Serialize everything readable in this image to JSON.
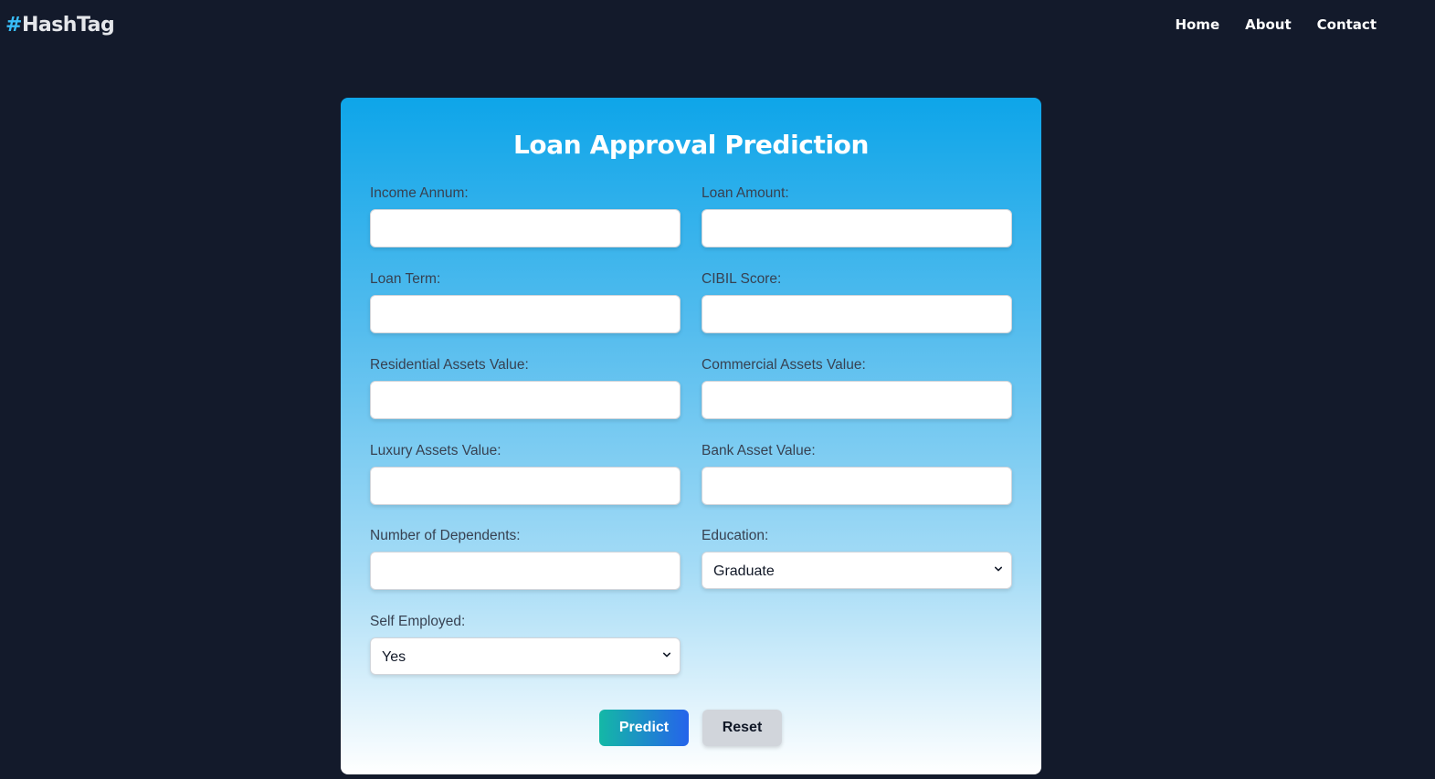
{
  "brand": {
    "hash": "#",
    "name": "HashTag"
  },
  "nav": {
    "links": [
      "Home",
      "About",
      "Contact"
    ]
  },
  "form": {
    "title": "Loan Approval Prediction",
    "fields": {
      "income_annum": {
        "label": "Income Annum:",
        "value": ""
      },
      "loan_amount": {
        "label": "Loan Amount:",
        "value": ""
      },
      "loan_term": {
        "label": "Loan Term:",
        "value": ""
      },
      "cibil_score": {
        "label": "CIBIL Score:",
        "value": ""
      },
      "residential_assets": {
        "label": "Residential Assets Value:",
        "value": ""
      },
      "commercial_assets": {
        "label": "Commercial Assets Value:",
        "value": ""
      },
      "luxury_assets": {
        "label": "Luxury Assets Value:",
        "value": ""
      },
      "bank_asset": {
        "label": "Bank Asset Value:",
        "value": ""
      },
      "dependents": {
        "label": "Number of Dependents:",
        "value": ""
      },
      "education": {
        "label": "Education:",
        "selected": "Graduate"
      },
      "self_employed": {
        "label": "Self Employed:",
        "selected": "Yes"
      }
    },
    "buttons": {
      "predict": "Predict",
      "reset": "Reset"
    }
  },
  "colors": {
    "background": "#131a2b",
    "brand_hash": "#38bdf8",
    "card_top": "#0ea5e9",
    "card_bottom": "#ffffff",
    "predict_start": "#14b8a6",
    "predict_end": "#2563eb",
    "reset_bg": "#d1d5db"
  }
}
